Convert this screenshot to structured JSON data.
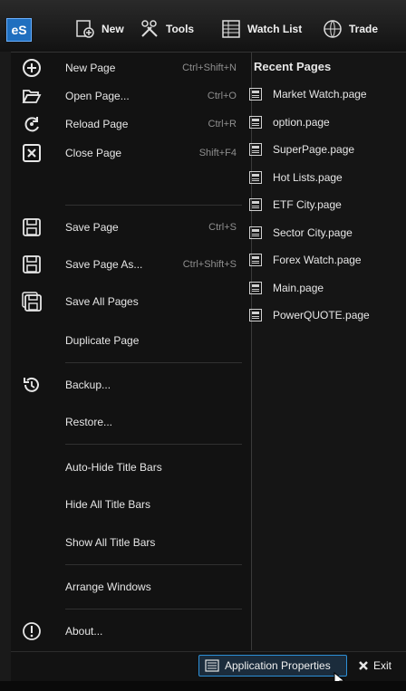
{
  "toolbar": {
    "logo": "eS",
    "buttons": [
      {
        "label": "New",
        "icon": "new-page-icon"
      },
      {
        "label": "Tools",
        "icon": "tools-icon"
      },
      {
        "label": "Watch List",
        "icon": "watchlist-icon"
      },
      {
        "label": "Trade",
        "icon": "trade-globe-icon"
      }
    ]
  },
  "menu": {
    "items": [
      {
        "label": "New Page",
        "shortcut": "Ctrl+Shift+N",
        "icon": "plus-circle-icon"
      },
      {
        "label": "Open Page...",
        "shortcut": "Ctrl+O",
        "icon": "folder-open-icon"
      },
      {
        "label": "Reload Page",
        "shortcut": "Ctrl+R",
        "icon": "reload-icon"
      },
      {
        "label": "Close Page",
        "shortcut": "Shift+F4",
        "icon": "close-square-icon"
      },
      {
        "label": "Save Page",
        "shortcut": "Ctrl+S",
        "icon": "save-icon"
      },
      {
        "label": "Save Page As...",
        "shortcut": "Ctrl+Shift+S",
        "icon": "save-as-icon"
      },
      {
        "label": "Save All Pages",
        "shortcut": "",
        "icon": "save-all-icon"
      },
      {
        "label": "Duplicate Page",
        "shortcut": "",
        "icon": ""
      },
      {
        "label": "Backup...",
        "shortcut": "",
        "icon": "backup-icon"
      },
      {
        "label": "Restore...",
        "shortcut": "",
        "icon": ""
      },
      {
        "label": "Auto-Hide Title Bars",
        "shortcut": "",
        "icon": ""
      },
      {
        "label": "Hide All Title Bars",
        "shortcut": "",
        "icon": ""
      },
      {
        "label": "Show All Title Bars",
        "shortcut": "",
        "icon": ""
      },
      {
        "label": "Arrange Windows",
        "shortcut": "",
        "icon": ""
      },
      {
        "label": "About...",
        "shortcut": "",
        "icon": "info-icon"
      }
    ]
  },
  "recent": {
    "title": "Recent Pages",
    "items": [
      "Market Watch.page",
      "option.page",
      "SuperPage.page",
      "Hot Lists.page",
      "ETF City.page",
      "Sector City.page",
      "Forex Watch.page",
      "Main.page",
      "PowerQUOTE.page"
    ]
  },
  "bottom": {
    "app_properties": "Application Properties",
    "exit": "Exit"
  }
}
